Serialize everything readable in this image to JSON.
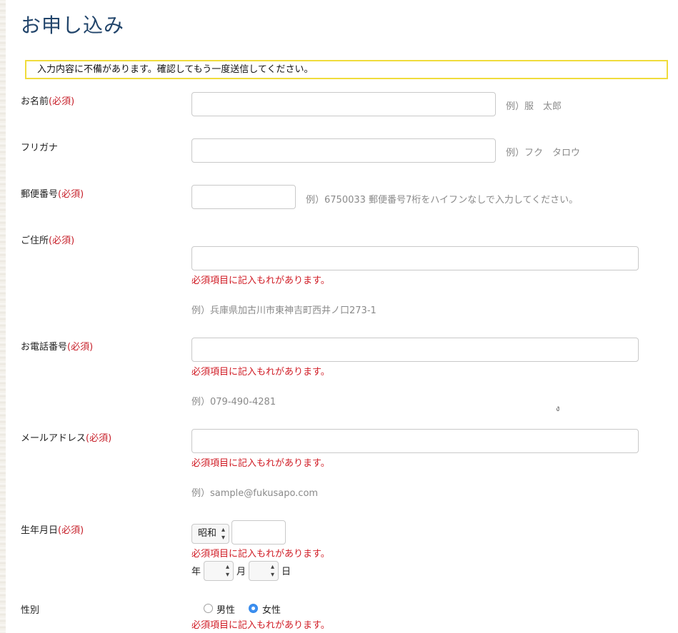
{
  "page": {
    "title": "お申し込み"
  },
  "alert": {
    "message": "入力内容に不備があります。確認してもう一度送信してください。"
  },
  "required_mark": "(必須)",
  "fields": {
    "name": {
      "label": "お名前",
      "value": "",
      "hint": "例）服　太郎"
    },
    "furigana": {
      "label": "フリガナ",
      "value": "",
      "hint": "例）フク　タロウ"
    },
    "postal": {
      "label": "郵便番号",
      "value": "",
      "hint": "例）6750033 郵便番号7桁をハイフンなしで入力してください。"
    },
    "address": {
      "label": "ご住所",
      "value": "",
      "error": "必須項目に記入もれがあります。",
      "hint": "例）兵庫県加古川市東神吉町西井ノ口273-1"
    },
    "phone": {
      "label": "お電話番号",
      "value": "",
      "error": "必須項目に記入もれがあります。",
      "hint": "例）079-490-4281"
    },
    "email": {
      "label": "メールアドレス",
      "value": "",
      "error": "必須項目に記入もれがあります。",
      "hint": "例）sample@fukusapo.com"
    },
    "birthdate": {
      "label": "生年月日",
      "era_selected": "昭和",
      "year_value": "",
      "error": "必須項目に記入もれがあります。",
      "year_unit": "年",
      "month_value": "",
      "month_unit": "月",
      "day_value": "",
      "day_unit": "日"
    },
    "gender": {
      "label": "性別",
      "options": [
        {
          "label": "男性",
          "selected": false
        },
        {
          "label": "女性",
          "selected": true
        }
      ],
      "error": "必須項目に記入もれがあります。"
    }
  },
  "colors": {
    "title": "#22456b",
    "required": "#c7212b",
    "error": "#d01b24",
    "alert_border": "#f0dc3c",
    "radio_selected": "#3d8ff0"
  }
}
